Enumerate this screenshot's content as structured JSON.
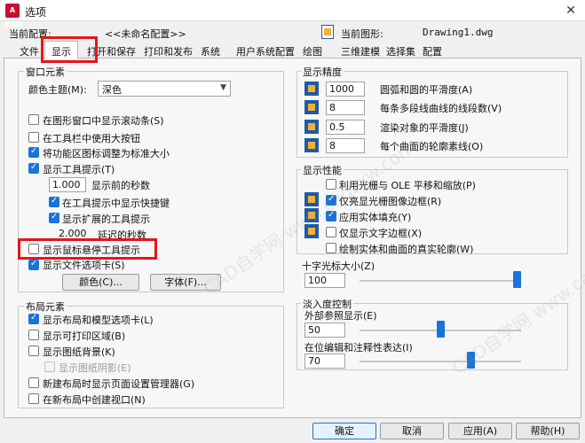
{
  "window": {
    "title": "选项",
    "app_badge": "A CAD",
    "close": "✕"
  },
  "header": {
    "current_profile_label": "当前配置:",
    "current_profile_value": "<<未命名配置>>",
    "current_drawing_label": "当前图形:",
    "current_drawing_value": "Drawing1.dwg"
  },
  "tabs": [
    "文件",
    "显示",
    "打开和保存",
    "打印和发布",
    "系统",
    "用户系统配置",
    "绘图",
    "三维建模",
    "选择集",
    "配置"
  ],
  "window_elements": {
    "title": "窗口元素",
    "color_theme_label": "颜色主题(M):",
    "color_theme_value": "深色",
    "checks": {
      "scrollbars": "在图形窗口中显示滚动条(S)",
      "large_buttons": "在工具栏中使用大按钮",
      "resize_icons": "将功能区图标调整为标准大小",
      "show_tooltips": "显示工具提示(T)",
      "shortcut_keys": "在工具提示中显示快捷键",
      "extended_tooltips": "显示扩展的工具提示",
      "rollover": "显示鼠标悬停工具提示",
      "file_tabs": "显示文件选项卡(S)"
    },
    "seconds_before_value": "1.000",
    "seconds_before_label": "显示前的秒数",
    "delay_value": "2.000",
    "delay_label": "延迟的秒数",
    "colors_button": "颜色(C)...",
    "fonts_button": "字体(F)..."
  },
  "layout_elements": {
    "title": "布局元素",
    "checks": {
      "layout_tabs": "显示布局和模型选项卡(L)",
      "printable_area": "显示可打印区域(B)",
      "paper_background": "显示图纸背景(K)",
      "paper_shadow": "显示图纸阴影(E)",
      "page_setup": "新建布局时显示页面设置管理器(G)",
      "create_viewport": "在新布局中创建视口(N)"
    }
  },
  "resolution": {
    "title": "显示精度",
    "rows": [
      {
        "value": "1000",
        "label": "圆弧和圆的平滑度(A)"
      },
      {
        "value": "8",
        "label": "每条多段线曲线的线段数(V)"
      },
      {
        "value": "0.5",
        "label": "渲染对象的平滑度(J)"
      },
      {
        "value": "8",
        "label": "每个曲面的轮廓素线(O)"
      }
    ]
  },
  "performance": {
    "title": "显示性能",
    "checks": {
      "raster_pan": "利用光栅与 OLE 平移和缩放(P)",
      "highlight_frame": "仅亮显光栅图像边框(R)",
      "solid_fill": "应用实体填充(Y)",
      "text_frame": "仅显示文字边框(X)",
      "true_silhouettes": "绘制实体和曲面的真实轮廓(W)"
    }
  },
  "crosshair": {
    "title": "十字光标大小(Z)",
    "value": "100",
    "fraction": 1.0
  },
  "fade": {
    "title": "淡入度控制",
    "xref_label": "外部参照显示(E)",
    "xref_value": "50",
    "xref_fraction": 0.5,
    "inplace_label": "在位编辑和注释性表达(I)",
    "inplace_value": "70",
    "inplace_fraction": 0.7
  },
  "footer": {
    "ok": "确定",
    "cancel": "取消",
    "apply": "应用(A)",
    "help": "帮助(H)"
  },
  "watermark": "CAD自学网 www.cadzxw.com",
  "colors": {
    "accent": "#1a73d9",
    "highlight_box": "#e8141c"
  }
}
